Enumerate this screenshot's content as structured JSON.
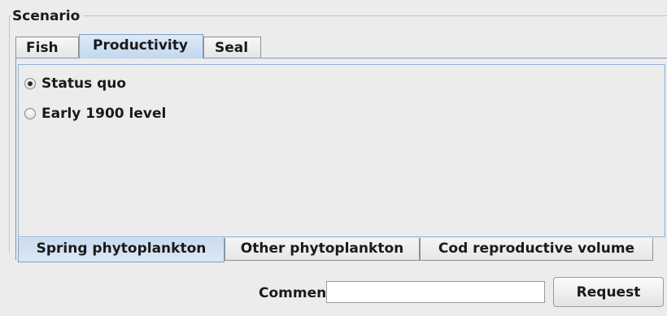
{
  "scenario": {
    "title": "Scenario",
    "tabs": [
      {
        "label": "Fish",
        "selected": false
      },
      {
        "label": "Productivity",
        "selected": true
      },
      {
        "label": "Seal",
        "selected": false
      }
    ],
    "options": [
      {
        "label": "Status quo",
        "checked": true
      },
      {
        "label": "Early 1900 level",
        "checked": false
      }
    ],
    "bottom_tabs": [
      {
        "label": "Spring phytoplankton",
        "selected": true
      },
      {
        "label": "Other phytoplankton",
        "selected": false
      },
      {
        "label": "Cod reproductive volume",
        "selected": false
      }
    ]
  },
  "footer": {
    "comment_label": "Comment:",
    "comment_value": "",
    "request_label": "Request"
  },
  "colors": {
    "selected_tab": "#c2d8ee",
    "panel_border": "#8fb0d8",
    "background": "#ececec"
  }
}
